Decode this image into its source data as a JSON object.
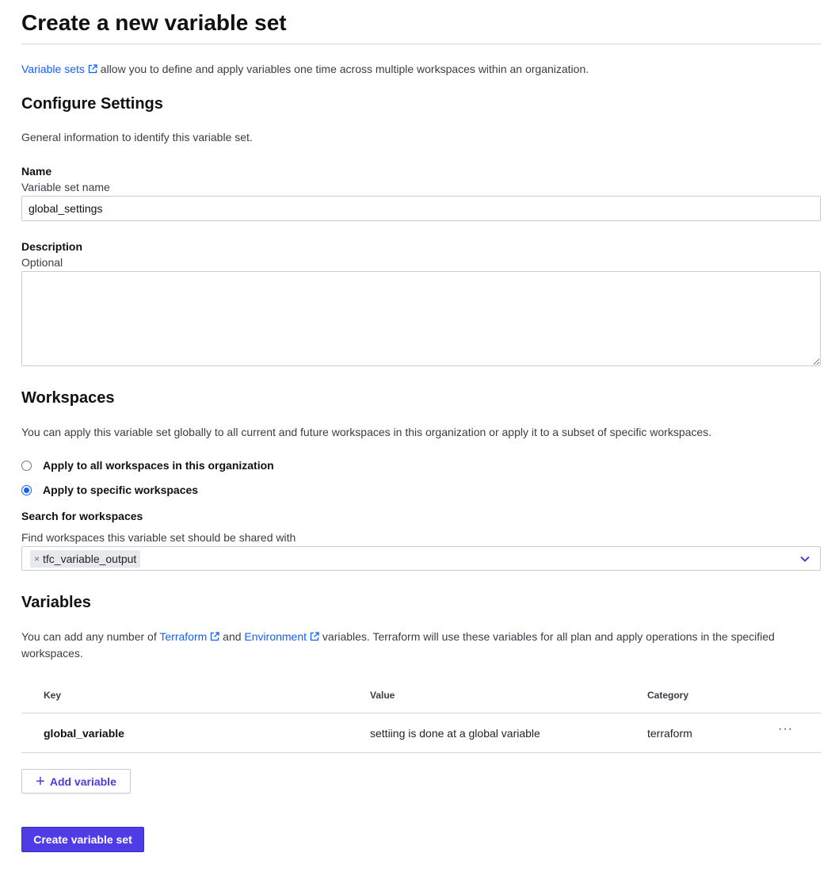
{
  "page": {
    "title": "Create a new variable set",
    "intro": {
      "link_label": "Variable sets",
      "text": "allow you to define and apply variables one time across multiple workspaces within an organization."
    }
  },
  "settings": {
    "heading": "Configure Settings",
    "description": "General information to identify this variable set.",
    "name_label": "Name",
    "name_sublabel": "Variable set name",
    "name_value": "global_settings",
    "description_label": "Description",
    "description_sublabel": "Optional",
    "description_value": ""
  },
  "workspaces": {
    "heading": "Workspaces",
    "description": "You can apply this variable set globally to all current and future workspaces in this organization or apply it to a subset of specific workspaces.",
    "options": [
      {
        "label": "Apply to all workspaces in this organization",
        "checked": false
      },
      {
        "label": "Apply to specific workspaces",
        "checked": true
      }
    ],
    "search_label": "Search for workspaces",
    "search_sublabel": "Find workspaces this variable set should be shared with",
    "selected": [
      {
        "remove_glyph": "×",
        "label": "tfc_variable_output"
      }
    ],
    "dropdown_icon": "chevron-down-icon"
  },
  "variables": {
    "heading": "Variables",
    "description_prefix": "You can add any number of",
    "terraform_link": "Terraform",
    "and_text": "and",
    "environment_link": "Environment",
    "description_line1_suffix": "variables. Terraform will use these variables for all plan and apply operations in the specified",
    "description_line2": "workspaces.",
    "columns": {
      "key": "Key",
      "value": "Value",
      "category": "Category"
    },
    "rows": [
      {
        "key": "global_variable",
        "value": "settiing is done at a global variable",
        "category": "terraform",
        "menu": "···"
      }
    ],
    "add_button": {
      "icon": "+",
      "label": "Add variable"
    }
  },
  "actions": {
    "submit_label": "Create variable set"
  },
  "colors": {
    "link": "#1060ff",
    "primary_button": "#4f3ce6",
    "secondary_button_text": "#4f3bd9",
    "border": "#c9ccd1"
  }
}
